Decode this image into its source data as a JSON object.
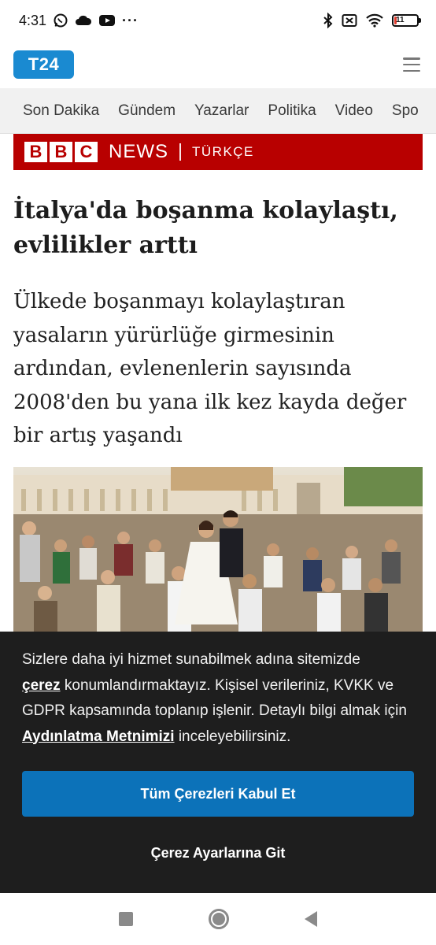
{
  "status_bar": {
    "time": "4:31",
    "dots": "···",
    "battery_level": "11",
    "battery_fraction": 0.11
  },
  "header": {
    "logo_text": "T24",
    "menu_icon": "hamburger-menu-icon"
  },
  "nav": {
    "items": [
      "Son Dakika",
      "Gündem",
      "Yazarlar",
      "Politika",
      "Video",
      "Spo"
    ]
  },
  "source_banner": {
    "blocks": [
      "B",
      "B",
      "C"
    ],
    "news": "NEWS",
    "edition": "TÜRKÇE"
  },
  "article": {
    "title_line1": "İtalya'da boşanma kolaylaştı,",
    "title_line2": "evlilikler arttı",
    "lead": "Ülkede boşanmayı kolaylaştıran yasaların yürürlüğe girmesinin ardından, evlenenlerin sayısında 2008'den bu yana ilk kez kayda değer bir artış yaşandı"
  },
  "cookie": {
    "text_part1": "Sizlere daha iyi hizmet sunabilmek adına sitemizde",
    "link_cookie": "çerez",
    "text_part2": "konumlandırmaktayız. Kişisel verileriniz, KVKK ve GDPR kapsamında toplanıp işlenir. Detaylı bilgi almak için",
    "link_policy": "Aydınlatma Metnimizi",
    "text_part3": "inceleyebilirsiniz.",
    "accept_label": "Tüm Çerezleri Kabul Et",
    "settings_label": "Çerez Ayarlarına Git"
  },
  "colors": {
    "brand_blue": "#1a8ad1",
    "bbc_red": "#b80000",
    "accept_button": "#0c72b9",
    "cookie_bg": "#1e1e1e"
  }
}
